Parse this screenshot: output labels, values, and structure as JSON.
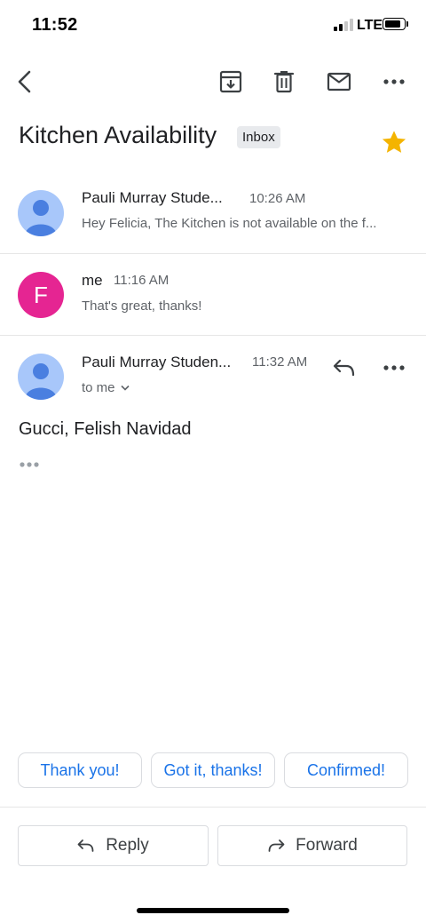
{
  "status_bar": {
    "time": "11:52",
    "network": "LTE"
  },
  "toolbar": {
    "icons": [
      "back-arrow-icon",
      "archive-icon",
      "trash-icon",
      "mail-icon",
      "more-icon"
    ]
  },
  "thread": {
    "subject": "Kitchen Availability",
    "label": "Inbox",
    "starred": true
  },
  "messages": [
    {
      "sender": "Pauli Murray Stude...",
      "time": "10:26 AM",
      "snippet": "Hey Felicia, The Kitchen is not available on the f..."
    },
    {
      "sender": "me",
      "avatar_letter": "F",
      "time": "11:16 AM",
      "snippet": "That's great, thanks!"
    },
    {
      "sender": "Pauli Murray Studen...",
      "time": "11:32 AM",
      "recipient": "to me",
      "body": "Gucci, Felish Navidad"
    }
  ],
  "smart_replies": [
    "Thank you!",
    "Got it, thanks!",
    "Confirmed!"
  ],
  "actions": {
    "reply": "Reply",
    "forward": "Forward"
  },
  "colors": {
    "accent": "#1a73e8",
    "star": "#f4b400",
    "avatar_blue": "#a8c7fa",
    "avatar_pink": "#e52592"
  }
}
